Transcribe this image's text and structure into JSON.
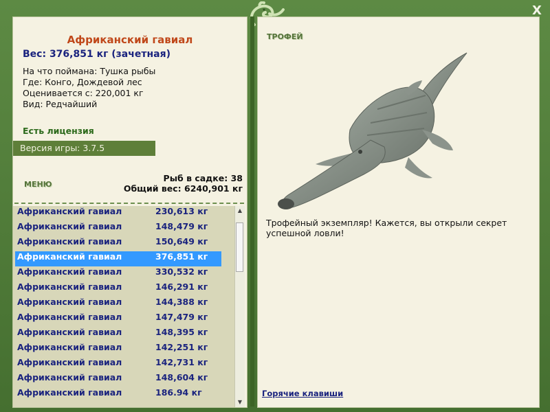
{
  "window": {
    "close_label": "X"
  },
  "fish": {
    "title": "Африканский гавиал",
    "weight": "Вес: 376,851 кг (зачетная)",
    "caught_with": "На что поймана: Тушка рыбы",
    "where": "Где: Конго, Дождевой лес",
    "valued_from": "Оценивается с: 220,001 кг",
    "kind": "Вид: Редчайший"
  },
  "license": "Есть лицензия",
  "version": "Версия игры: 3.7.5",
  "menu_label": "МЕНЮ",
  "stats": {
    "count": "Рыб в садке: 38",
    "total": "Общий вес: 6240,901 кг"
  },
  "list": [
    {
      "name": "Африканский гавиал",
      "weight": "230,613 кг"
    },
    {
      "name": "Африканский гавиал",
      "weight": "148,479 кг"
    },
    {
      "name": "Африканский гавиал",
      "weight": "150,649 кг"
    },
    {
      "name": "Африканский гавиал",
      "weight": "376,851 кг"
    },
    {
      "name": "Африканский гавиал",
      "weight": "330,532 кг"
    },
    {
      "name": "Африканский гавиал",
      "weight": "146,291 кг"
    },
    {
      "name": "Африканский гавиал",
      "weight": "144,388 кг"
    },
    {
      "name": "Африканский гавиал",
      "weight": "147,479 кг"
    },
    {
      "name": "Африканский гавиал",
      "weight": "148,395 кг"
    },
    {
      "name": "Африканский гавиал",
      "weight": "142,251 кг"
    },
    {
      "name": "Африканский гавиал",
      "weight": "142,731 кг"
    },
    {
      "name": "Африканский гавиал",
      "weight": "148,604 кг"
    },
    {
      "name": "Африканский гавиал",
      "weight": "186.94 кг"
    }
  ],
  "selected_index": 3,
  "trophy": {
    "label": "ТРОФЕЙ",
    "description": "Трофейный экземпляр! Кажется, вы открыли секрет успешной ловли!"
  },
  "hotkeys_label": "Горячие клавиши",
  "colors": {
    "frame": "#4e7a38",
    "panel": "#f5f2e2",
    "selection": "#3399ff",
    "title": "#c0481a",
    "list_text": "#1a237e"
  }
}
